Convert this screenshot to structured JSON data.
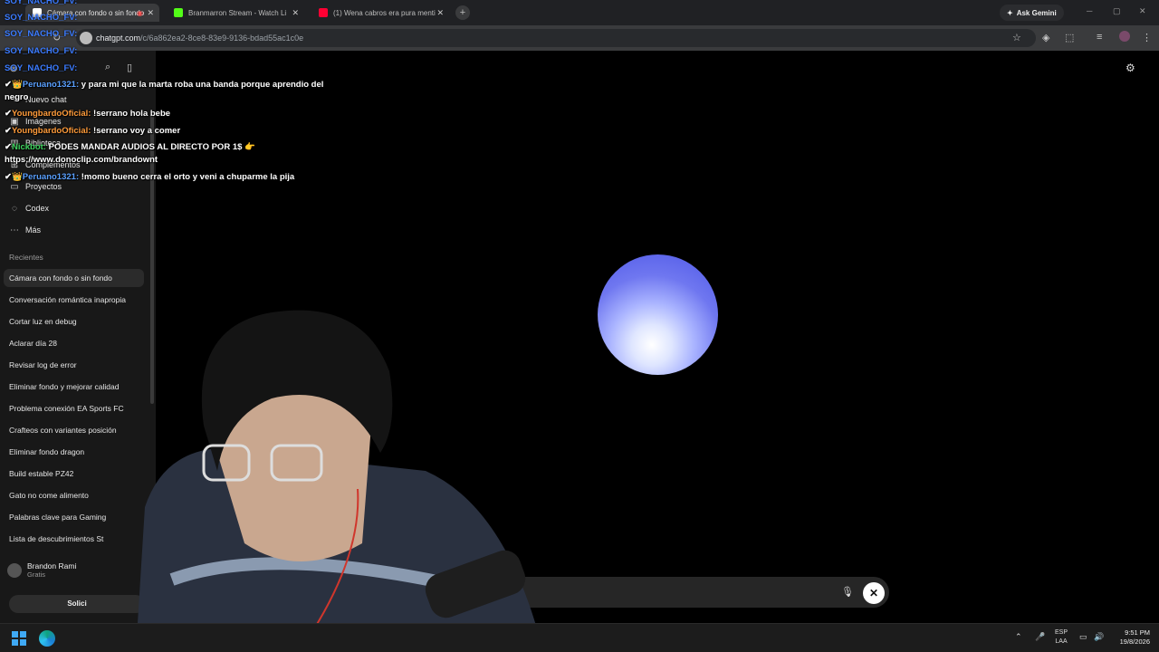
{
  "browser": {
    "tabs": [
      {
        "title": "Cámara con fondo o sin fondo",
        "color": "#ffffff"
      },
      {
        "title": "Branmarron Stream - Watch Li",
        "color": "#53fc18"
      },
      {
        "title": "(1) Wena cabros era pura menti",
        "color": "#ff0033"
      }
    ],
    "new_tab": "+",
    "ask_gemini": "Ask Gemini",
    "url_host": "chatgpt.com",
    "url_path": "/c/6a862ea2-8ce8-83e9-9136-bdad55ac1c0e"
  },
  "sidebar": {
    "nav": [
      {
        "label": "Nuevo chat",
        "icon": "edit-icon"
      },
      {
        "label": "Imágenes",
        "icon": "image-icon"
      },
      {
        "label": "Biblioteca",
        "icon": "library-icon"
      },
      {
        "label": "Complementos",
        "icon": "plugins-icon"
      },
      {
        "label": "Proyectos",
        "icon": "folder-icon"
      },
      {
        "label": "Codex",
        "icon": "codex-icon"
      },
      {
        "label": "Más",
        "icon": "more-icon"
      }
    ],
    "recents_heading": "Recientes",
    "recents": [
      "Cámara con fondo o sin fondo",
      "Conversación romántica inapropia",
      "Cortar luz en debug",
      "Aclarar día 28",
      "Revisar log de error",
      "Eliminar fondo y mejorar calidad",
      "Problema conexión EA Sports FC",
      "Crafteos con variantes posición",
      "Eliminar fondo dragon",
      "Build estable PZ42",
      "Gato no come alimento",
      "Palabras clave para Gaming",
      "Lista de descubrimientos St"
    ],
    "user_name": "Brandon Rami",
    "user_plan": "Gratis",
    "upgrade_label": "Solici"
  },
  "chat_overlay": {
    "repeat_user": "SOY_NACHO_FV:",
    "messages": [
      {
        "user": "Peruano1321:",
        "text": "y para mi que la marta roba una banda porque aprendio del",
        "cont": "negro",
        "color": "blue"
      },
      {
        "user": "YoungbardoOficial:",
        "text": "!serrano hola bebe",
        "color": "orange"
      },
      {
        "user": "YoungbardoOficial:",
        "text": "!serrano voy a comer",
        "color": "orange"
      },
      {
        "user": "Nickbot:",
        "text": "PODES MANDAR AUDIOS AL DIRECTO POR 1$ 👉",
        "cont": "https://www.donoclip.com/brandownt",
        "color": "green"
      },
      {
        "user": "Peruano1321:",
        "text": "!momo bueno cerra el orto y veni a chuparme la pija",
        "color": "blue"
      }
    ]
  },
  "taskbar": {
    "lang_top": "ESP",
    "lang_bottom": "LAA",
    "time": "9:51 PM",
    "date": "19/8/2026"
  },
  "colors": {
    "accent_orb": "#5a62ee",
    "sidebar_bg": "#181818"
  }
}
